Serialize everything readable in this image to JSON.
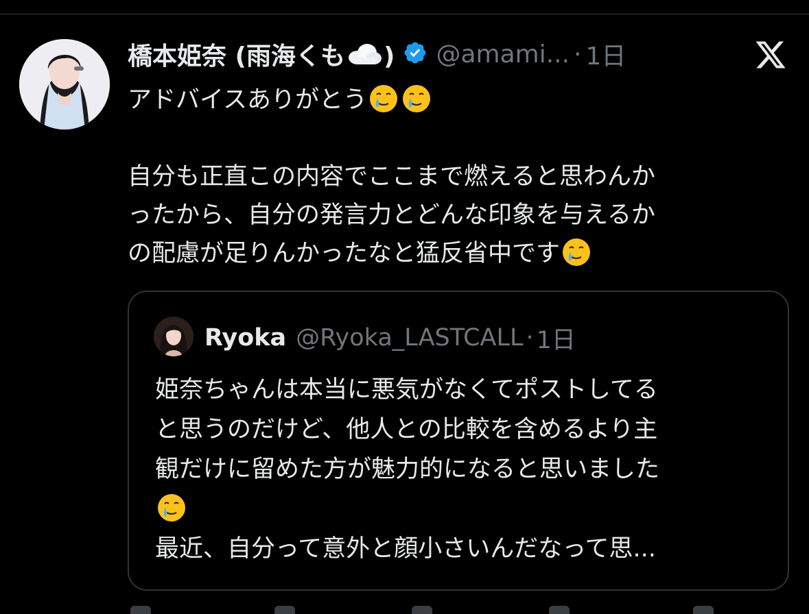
{
  "author": {
    "display_name_prefix": "橋本姫奈 (雨海くも",
    "display_name_suffix": ")",
    "handle": "@amami...",
    "separator": "·",
    "time": "1日",
    "verified": true
  },
  "post": {
    "line1": "アドバイスありがとう",
    "line2": "自分も正直この内容でここまで燃えると思わんか",
    "line3": "ったから、自分の発言力とどんな印象を与えるか",
    "line4": "の配慮が足りんかったなと猛反省中です"
  },
  "quote": {
    "display_name": "Ryoka",
    "handle": "@Ryoka_LASTCALL",
    "separator": "·",
    "time": "1日",
    "line1": "姫奈ちゃんは本当に悪気がなくてポストしてる",
    "line2": "と思うのだけど、他人との比較を含めるより主",
    "line3": "観だけに留めた方が魅力的になると思いました",
    "line5": "最近、自分って意外と顔小さいんだなって思..."
  },
  "icons": {
    "verified_color": "#1d9bf0",
    "emoji": "face-holding-back-tears"
  },
  "colors": {
    "background": "#000000",
    "text": "#e7e9ea",
    "muted": "#71767b",
    "border": "#2f3336"
  }
}
